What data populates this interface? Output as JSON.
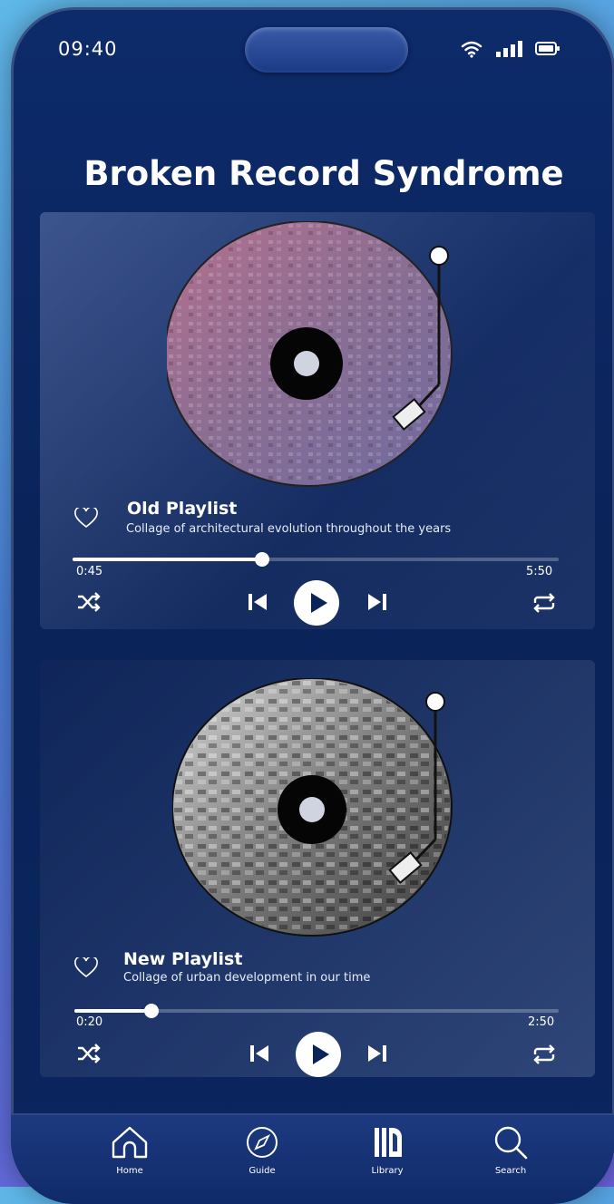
{
  "status": {
    "time": "09:40"
  },
  "title": "Broken Record Syndrome",
  "playlists": [
    {
      "name": "Old Playlist",
      "description": "Collage of architectural evolution throughout the years",
      "elapsed": "0:45",
      "duration": "5:50",
      "progress": 0.39
    },
    {
      "name": "New Playlist",
      "description": "Collage of urban development in our time",
      "elapsed": "0:20",
      "duration": "2:50",
      "progress": 0.16
    }
  ],
  "nav": {
    "home": "Home",
    "guide": "Guide",
    "library": "Library",
    "search": "Search"
  },
  "icons": [
    "wifi-icon",
    "signal-icon",
    "battery-icon",
    "heart-icon",
    "shuffle-icon",
    "previous-icon",
    "play-icon",
    "next-icon",
    "repeat-icon",
    "home-icon",
    "compass-icon",
    "library-icon",
    "search-icon"
  ],
  "colors": {
    "background": "#0a2358",
    "accent": "#ffffff"
  }
}
